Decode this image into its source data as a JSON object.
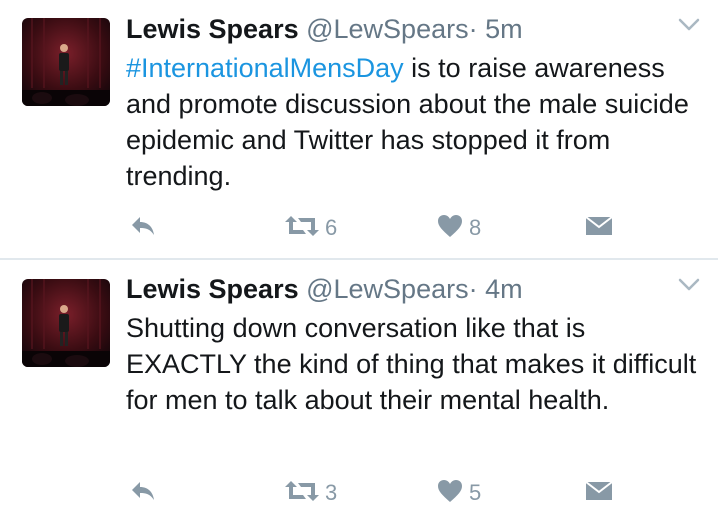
{
  "colors": {
    "link": "#1b95e0",
    "icon": "#8899a6",
    "text": "#14171a",
    "muted": "#657786"
  },
  "tweets": [
    {
      "name": "Lewis Spears",
      "handle": "@LewSpears",
      "dot": "·",
      "time": "5m",
      "hashtag": "#InternationalMensDay",
      "text": " is to raise awareness and promote discussion about the male suicide epidemic and Twitter has stopped it from trending.",
      "retweets": "6",
      "likes": "8"
    },
    {
      "name": "Lewis Spears",
      "handle": "@LewSpears",
      "dot": "·",
      "time": "4m",
      "hashtag": "",
      "text": "Shutting down conversation like that is EXACTLY the kind of thing that makes it difficult for men to talk about their mental health.",
      "retweets": "3",
      "likes": "5"
    }
  ],
  "icons": {
    "avatar": "avatar-photo",
    "chevron": "chevron-down-icon",
    "reply": "reply-icon",
    "retweet": "retweet-icon",
    "like": "heart-icon",
    "dm": "direct-message-icon"
  }
}
